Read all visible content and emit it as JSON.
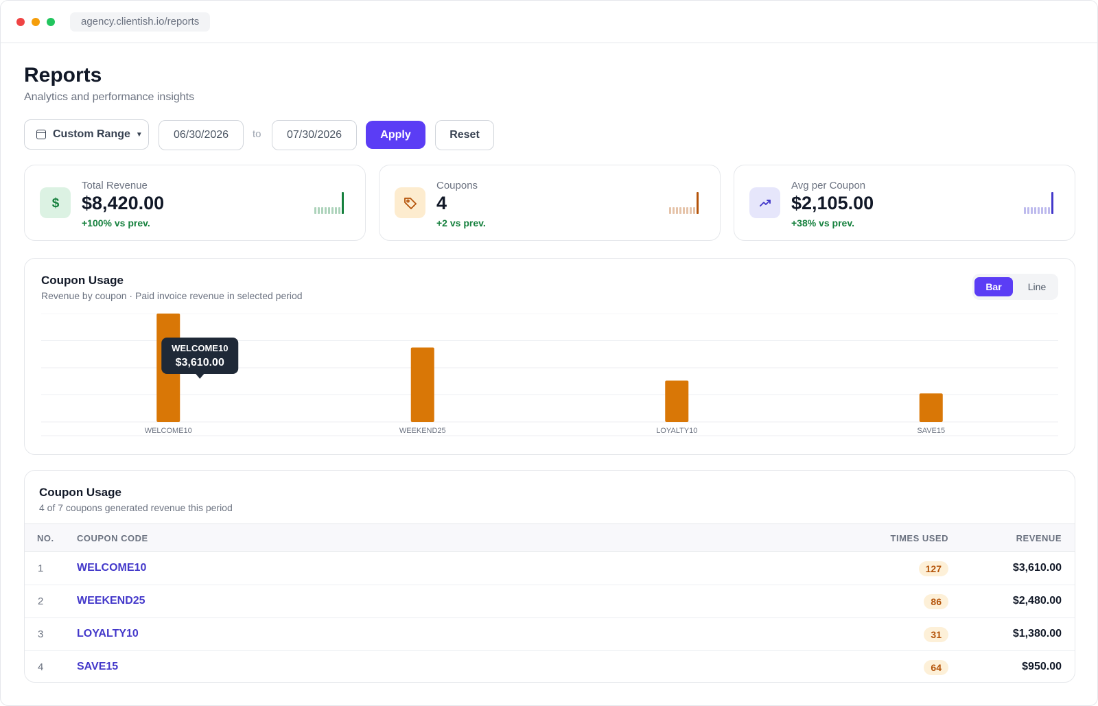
{
  "browser": {
    "url": "agency.clientish.io/reports"
  },
  "header": {
    "title": "Reports",
    "subtitle": "Analytics and performance insights"
  },
  "filters": {
    "range_label": "Custom Range",
    "from_date": "06/30/2026",
    "to_label": "to",
    "to_date": "07/30/2026",
    "apply_label": "Apply",
    "reset_label": "Reset"
  },
  "kpis": [
    {
      "label": "Total Revenue",
      "value": "$8,420.00",
      "delta": "+100% vs prev.",
      "icon": "dollar-icon",
      "accent": "#15803d",
      "tint": "#dcf2e3"
    },
    {
      "label": "Coupons",
      "value": "4",
      "delta": "+2 vs prev.",
      "icon": "tag-icon",
      "accent": "#b45309",
      "tint": "#fdeccf"
    },
    {
      "label": "Avg per Coupon",
      "value": "$2,105.00",
      "delta": "+38% vs prev.",
      "icon": "trend-up-icon",
      "accent": "#4338ca",
      "tint": "#e6e6fb"
    }
  ],
  "chart_panel": {
    "title": "Coupon Usage",
    "subtitle": "Revenue by coupon · Paid invoice revenue in selected period",
    "toggle": {
      "bar": "Bar",
      "line": "Line",
      "active": "Bar"
    },
    "tooltip": {
      "label": "WELCOME10",
      "value": "$3,610.00"
    }
  },
  "chart_data": {
    "type": "bar",
    "categories": [
      "WELCOME10",
      "WEEKEND25",
      "LOYALTY10",
      "SAVE15"
    ],
    "values": [
      3610,
      2480,
      1380,
      950
    ],
    "ylim": [
      0,
      3610
    ],
    "grid": true,
    "bar_color": "#d97706",
    "title": "Coupon Usage",
    "xlabel": "",
    "ylabel": ""
  },
  "table": {
    "title": "Coupon Usage",
    "subtitle": "4 of 7 coupons generated revenue this period",
    "columns": {
      "no": "NO.",
      "code": "COUPON CODE",
      "used": "TIMES USED",
      "revenue": "REVENUE"
    },
    "rows": [
      {
        "no": "1",
        "code": "WELCOME10",
        "used": "127",
        "revenue": "$3,610.00"
      },
      {
        "no": "2",
        "code": "WEEKEND25",
        "used": "86",
        "revenue": "$2,480.00"
      },
      {
        "no": "3",
        "code": "LOYALTY10",
        "used": "31",
        "revenue": "$1,380.00"
      },
      {
        "no": "4",
        "code": "SAVE15",
        "used": "64",
        "revenue": "$950.00"
      }
    ]
  },
  "colors": {
    "primary": "#5b3df5",
    "bar": "#d97706",
    "link": "#4338ca",
    "positive": "#15803d"
  }
}
